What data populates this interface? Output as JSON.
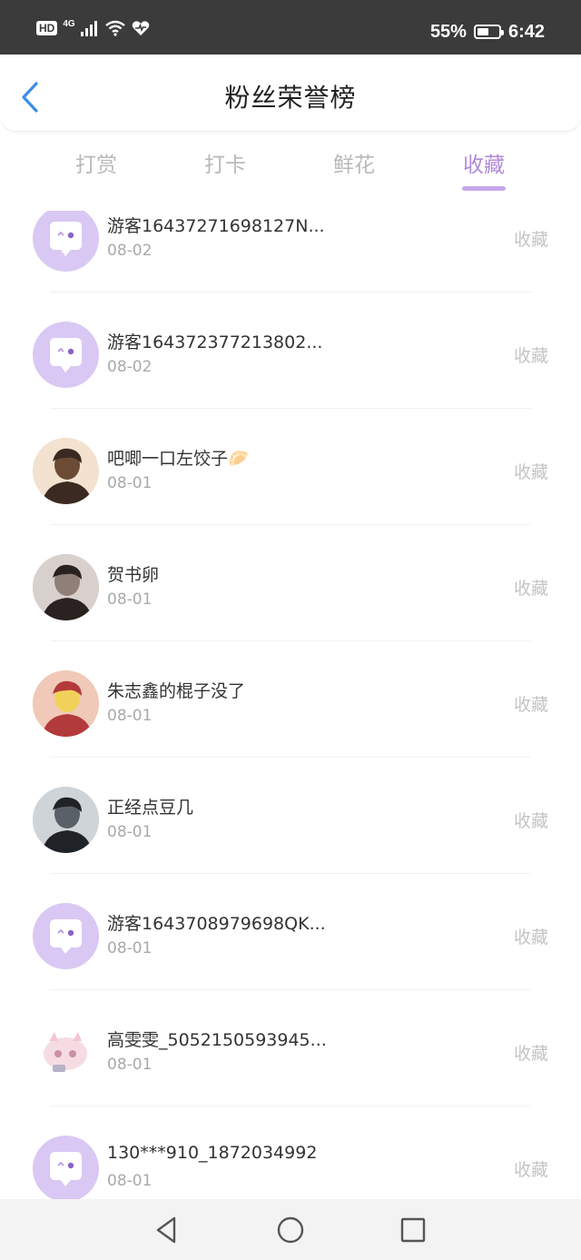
{
  "status_bar": {
    "hd": "HD",
    "network": "4G",
    "battery_text": "55%",
    "battery_level": 0.55,
    "time": "6:42"
  },
  "header": {
    "title": "粉丝荣誉榜"
  },
  "tabs": [
    {
      "label": "打赏",
      "active": false
    },
    {
      "label": "打卡",
      "active": false
    },
    {
      "label": "鲜花",
      "active": false
    },
    {
      "label": "收藏",
      "active": true
    }
  ],
  "accent_color": "#b08ad9",
  "list": {
    "items": [
      {
        "name": "游客16437271698127N...",
        "date": "08-02",
        "action": "收藏",
        "avatar": "default-chat-avatar"
      },
      {
        "name": "游客164372377213802...",
        "date": "08-02",
        "action": "收藏",
        "avatar": "default-chat-avatar"
      },
      {
        "name": "吧唧一口左饺子🥟",
        "date": "08-01",
        "action": "收藏",
        "avatar": "photo-avatar"
      },
      {
        "name": "贺书卵",
        "date": "08-01",
        "action": "收藏",
        "avatar": "photo-avatar"
      },
      {
        "name": "朱志鑫的棍子没了",
        "date": "08-01",
        "action": "收藏",
        "avatar": "photo-avatar"
      },
      {
        "name": "正经点豆几",
        "date": "08-01",
        "action": "收藏",
        "avatar": "photo-avatar"
      },
      {
        "name": "游客1643708979698QK...",
        "date": "08-01",
        "action": "收藏",
        "avatar": "default-chat-avatar"
      },
      {
        "name": "高雯雯_5052150593945...",
        "date": "08-01",
        "action": "收藏",
        "avatar": "sticker-avatar"
      },
      {
        "name": "130***910_1872034992",
        "date": "08-01",
        "action": "收藏",
        "avatar": "default-chat-avatar"
      }
    ]
  },
  "nav_bar": {
    "icons": [
      "back-triangle-icon",
      "home-circle-icon",
      "recents-square-icon"
    ]
  }
}
